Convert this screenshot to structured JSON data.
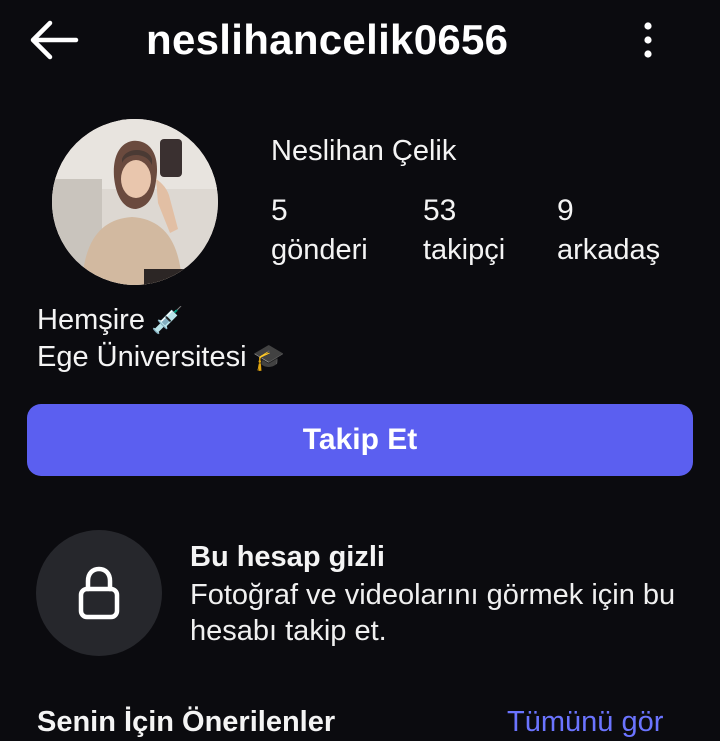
{
  "header": {
    "back_icon": "arrow-left-icon",
    "username": "neslihancelik0656",
    "more_icon": "more-vertical-icon"
  },
  "profile": {
    "avatar": "profile-photo",
    "display_name": "Neslihan Çelik",
    "stats": [
      {
        "value": "5",
        "label": "gönderi"
      },
      {
        "value": "53",
        "label": "takipçi"
      },
      {
        "value": "9",
        "label": "arkadaş"
      }
    ],
    "bio": [
      {
        "text": "Hemşire",
        "emoji": "💉"
      },
      {
        "text": "Ege Üniversitesi",
        "emoji": "🎓"
      }
    ]
  },
  "actions": {
    "follow_label": "Takip Et",
    "follow_color": "#5b5ff0"
  },
  "private": {
    "icon": "lock-icon",
    "title": "Bu hesap gizli",
    "description": "Fotoğraf ve videolarını görmek için bu hesabı takip et."
  },
  "suggestions": {
    "title": "Senin İçin Önerilenler",
    "see_all_label": "Tümünü gör",
    "see_all_color": "#6b74ff"
  }
}
